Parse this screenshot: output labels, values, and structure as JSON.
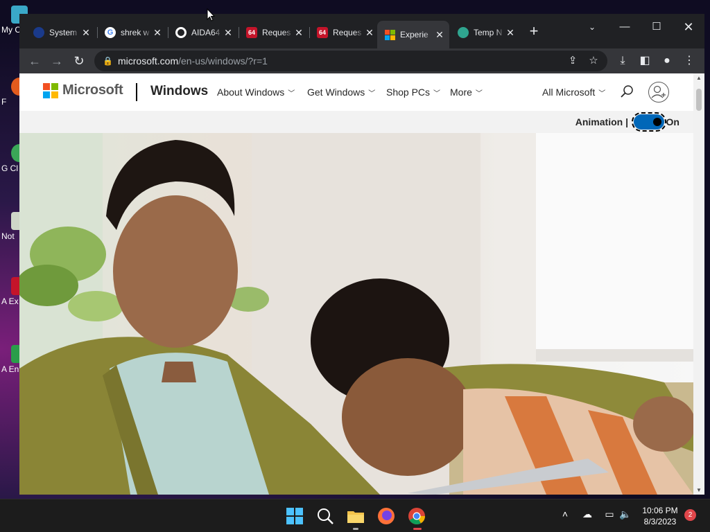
{
  "desktop": {
    "icons": [
      {
        "label": "My C"
      },
      {
        "label": "F"
      },
      {
        "label": "G Cl"
      },
      {
        "label": "Not"
      },
      {
        "label": "A Ex"
      },
      {
        "label": "A En"
      }
    ]
  },
  "browser": {
    "tabs": [
      {
        "title": "System",
        "favicon": "system-favicon",
        "active": false
      },
      {
        "title": "shrek w",
        "favicon": "google-favicon",
        "active": false
      },
      {
        "title": "AIDA64",
        "favicon": "github-favicon",
        "active": false
      },
      {
        "title": "Reques",
        "favicon": "aida64-favicon",
        "favicon_text": "64",
        "active": false
      },
      {
        "title": "Reques",
        "favicon": "aida64-favicon",
        "favicon_text": "64",
        "active": false
      },
      {
        "title": "Experie",
        "favicon": "microsoft-favicon",
        "active": true
      },
      {
        "title": "Temp N",
        "favicon": "tempmail-favicon",
        "active": false
      }
    ],
    "address": {
      "host": "microsoft.com",
      "path": "/en-us/windows/?r=1"
    }
  },
  "page": {
    "header": {
      "brand": "Microsoft",
      "product": "Windows",
      "nav": [
        {
          "label": "About Windows"
        },
        {
          "label": "Get Windows"
        },
        {
          "label": "Shop PCs"
        },
        {
          "label": "More"
        }
      ],
      "all_microsoft": "All Microsoft"
    },
    "animation": {
      "label": "Animation |",
      "state": "On"
    },
    "hero": {
      "description": "Father and son smiling while looking at a laptop"
    }
  },
  "taskbar": {
    "time": "10:06 PM",
    "date": "8/3/2023",
    "notification_count": "2"
  },
  "colors": {
    "ms_red": "#f25022",
    "ms_green": "#7fba00",
    "ms_blue": "#00a4ef",
    "ms_yellow": "#ffb900",
    "toggle_blue": "#0067b8",
    "browser_dark": "#202124"
  }
}
